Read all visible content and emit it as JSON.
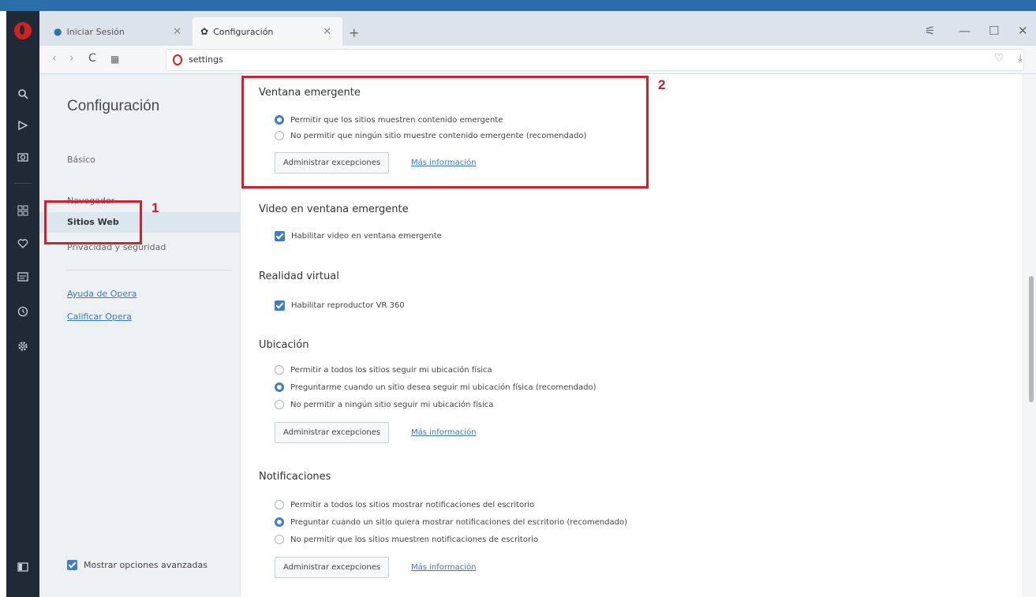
{
  "tabs": [
    {
      "label": "Iniciar Sesión",
      "icon": "opera-page-icon"
    },
    {
      "label": "Configuración",
      "icon": "gear-icon"
    }
  ],
  "address": {
    "url": "settings"
  },
  "settings_nav": {
    "title": "Configuración",
    "items": [
      "Básico",
      "Navegador",
      "Sitios Web",
      "Privacidad y seguridad"
    ],
    "links": [
      "Ayuda de Opera",
      "Calificar Opera"
    ],
    "advanced_label": "Mostrar opciones avanzadas"
  },
  "sections": {
    "popup": {
      "title": "Ventana emergente",
      "options": [
        "Permitir que los sitios muestren contenido emergente",
        "No permitir que ningún sitio muestre contenido emergente (recomendado)"
      ],
      "manage_label": "Administrar excepciones",
      "more_label": "Más información"
    },
    "video_popup": {
      "title": "Video en ventana emergente",
      "checkbox": "Habilitar video en ventana emergente"
    },
    "vr": {
      "title": "Realidad virtual",
      "checkbox": "Habilitar reproductor VR 360"
    },
    "location": {
      "title": "Ubicación",
      "options": [
        "Permitir a todos los sitios seguir mi ubicación física",
        "Preguntarme cuando un sitio desea seguir mi ubicación física (recomendado)",
        "No permitir a ningún sitio seguir mi ubicación física"
      ],
      "manage_label": "Administrar excepciones",
      "more_label": "Más información"
    },
    "notifications": {
      "title": "Notificaciones",
      "options": [
        "Permitir a todos los sitios mostrar notificaciones del escritorio",
        "Preguntar cuando un sitio quiera mostrar notificaciones del escritorio (recomendado)",
        "No permitir que los sitios muestren notificaciones de escritorio"
      ],
      "manage_label": "Administrar excepciones",
      "more_label": "Más información"
    }
  },
  "annotations": {
    "box1": "1",
    "box2": "2"
  },
  "colors": {
    "accent": "#3f7fc1",
    "annotation": "#d0212f",
    "opera_red": "#d2221f"
  }
}
